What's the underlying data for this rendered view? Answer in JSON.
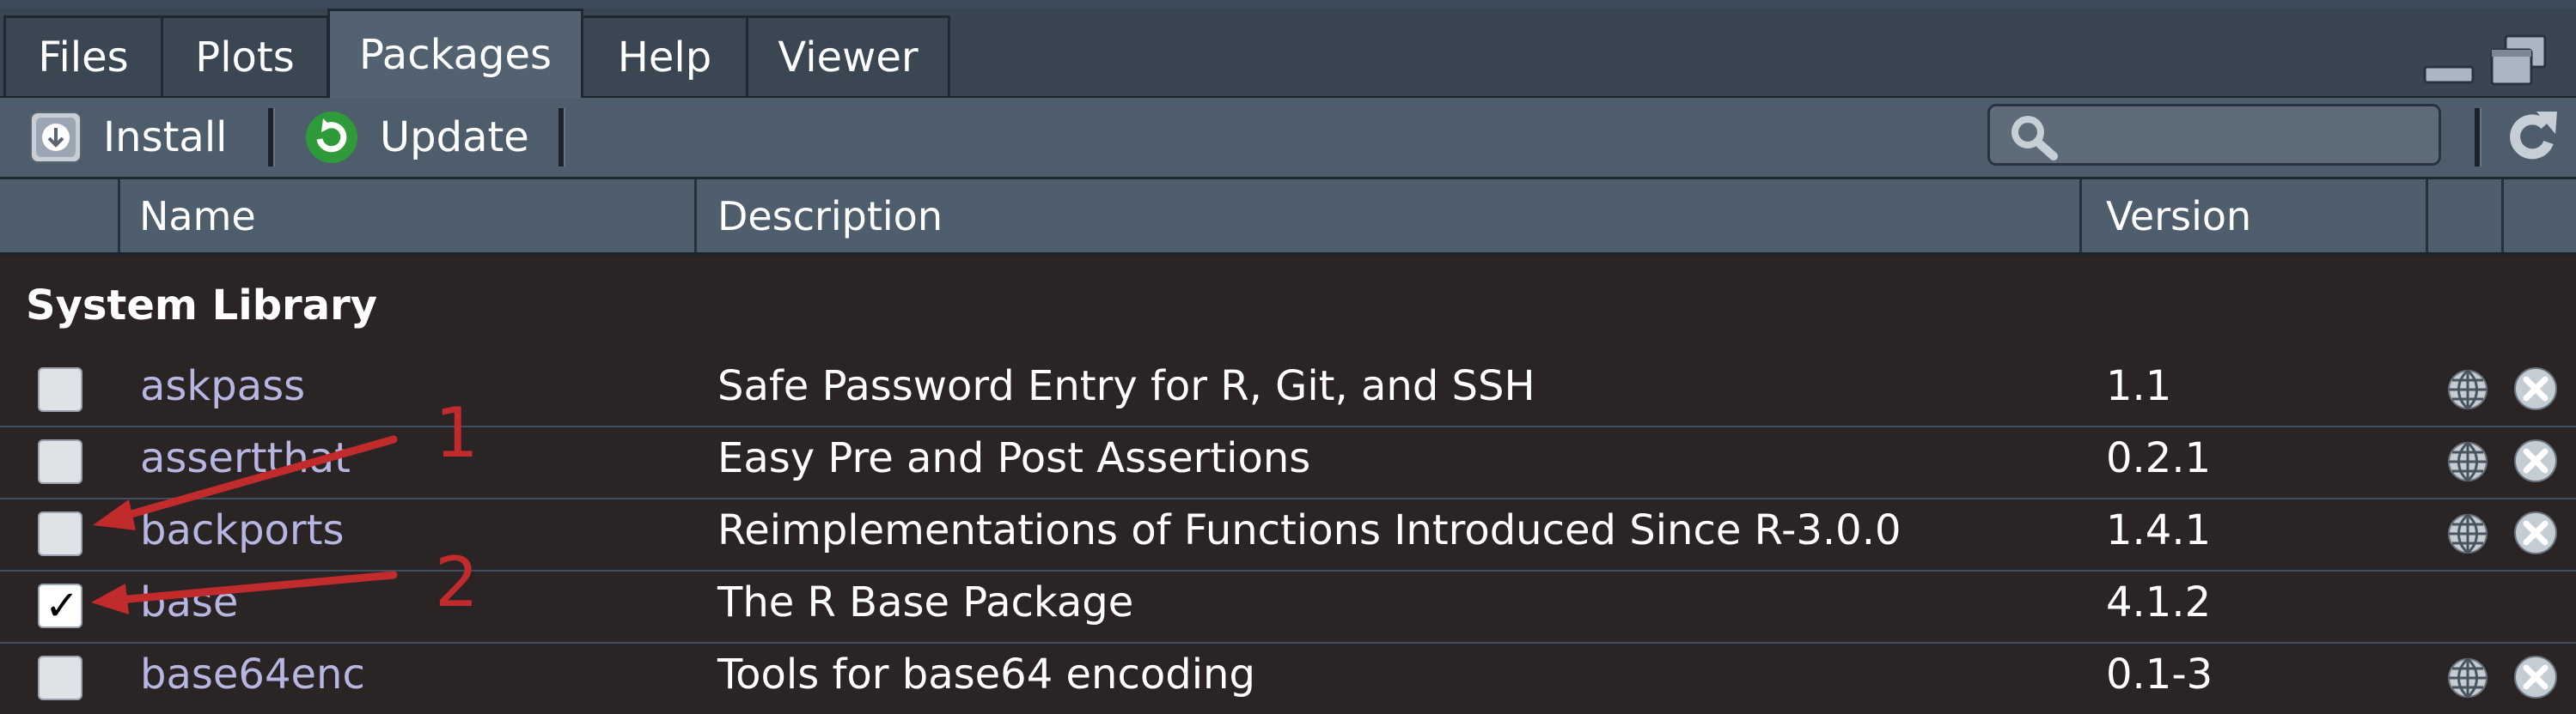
{
  "tabs": [
    {
      "label": "Files"
    },
    {
      "label": "Plots"
    },
    {
      "label": "Packages"
    },
    {
      "label": "Help"
    },
    {
      "label": "Viewer"
    }
  ],
  "toolbar": {
    "install_label": "Install",
    "update_label": "Update",
    "search_value": ""
  },
  "columns": {
    "name": "Name",
    "description": "Description",
    "version": "Version"
  },
  "section_title": "System Library",
  "packages": [
    {
      "name": "askpass",
      "description": "Safe Password Entry for R, Git, and SSH",
      "version": "1.1",
      "checked": false,
      "has_actions": true
    },
    {
      "name": "assertthat",
      "description": "Easy Pre and Post Assertions",
      "version": "0.2.1",
      "checked": false,
      "has_actions": true
    },
    {
      "name": "backports",
      "description": "Reimplementations of Functions Introduced Since R-3.0.0",
      "version": "1.4.1",
      "checked": false,
      "has_actions": true
    },
    {
      "name": "base",
      "description": "The R Base Package",
      "version": "4.1.2",
      "checked": true,
      "has_actions": false
    },
    {
      "name": "base64enc",
      "description": "Tools for base64 encoding",
      "version": "0.1-3",
      "checked": false,
      "has_actions": true
    }
  ],
  "annotations": [
    {
      "label": "1"
    },
    {
      "label": "2"
    }
  ],
  "colors": {
    "annotation_red": "#c22b2b",
    "package_link": "#b7b6e2",
    "update_green": "#2e9a3a"
  }
}
